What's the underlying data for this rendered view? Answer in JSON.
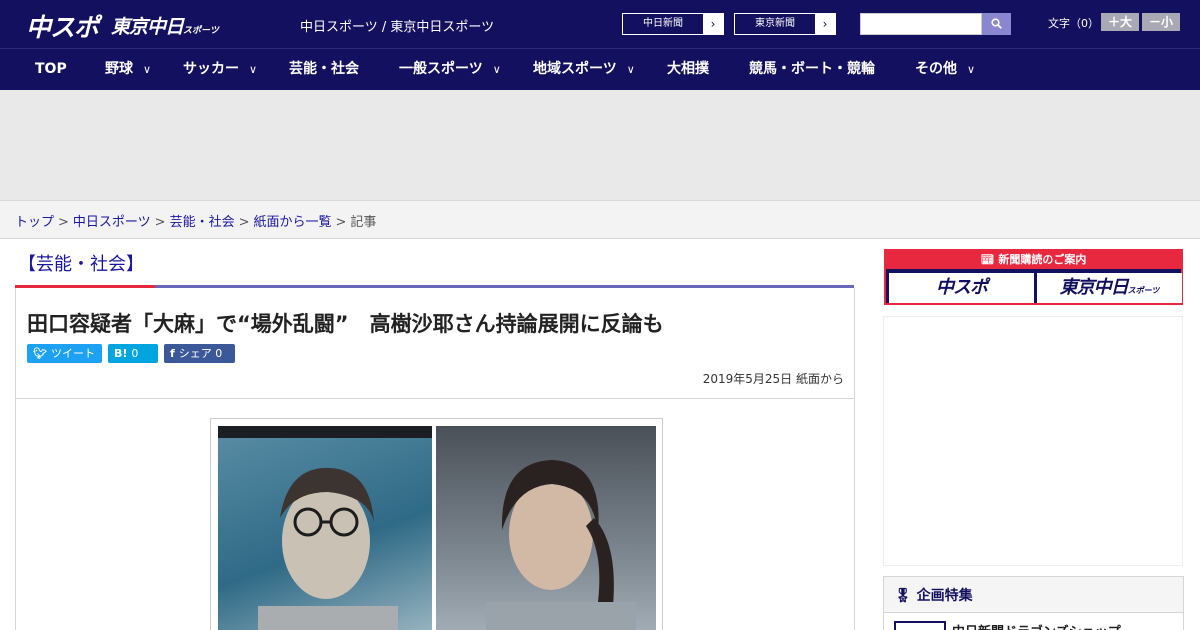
{
  "header": {
    "logo_chuspo": "中スポ",
    "logo_tokyo": "東京中日",
    "logo_tokyo_suffix": "スポーツ",
    "site_links": "中日スポーツ / 東京中日スポーツ",
    "paper_links": [
      "中日新聞",
      "東京新聞"
    ],
    "search": {
      "placeholder": "",
      "value": ""
    },
    "fontsize_label": "文字（0）",
    "fontsize_up": "＋大",
    "fontsize_down": "－小"
  },
  "nav": {
    "items": [
      {
        "label": "TOP"
      },
      {
        "label": "野球"
      },
      {
        "label": "サッカー"
      },
      {
        "label": "芸能・社会"
      },
      {
        "label": "一般スポーツ"
      },
      {
        "label": "地域スポーツ"
      },
      {
        "label": "大相撲"
      },
      {
        "label": "競馬・ボート・競輪"
      },
      {
        "label": "その他"
      }
    ]
  },
  "breadcrumb": {
    "items": [
      "トップ",
      "中日スポーツ",
      "芸能・社会",
      "紙面から一覧"
    ],
    "current": "記事",
    "separator": ">"
  },
  "article": {
    "section": "【芸能・社会】",
    "headline": "田口容疑者「大麻」で“場外乱闘”　高樹沙耶さん持論展開に反論も",
    "share": {
      "tweet_label": "ツイート",
      "hatena_count": "0",
      "facebook_label": "シェア",
      "facebook_count": "0"
    },
    "dateline": "2019年5月25日 紙面から"
  },
  "sidebar": {
    "subscribe_title": "新聞購読のご案内",
    "subscribe_logo_1": "中スポ",
    "subscribe_logo_2": "東京中日",
    "subscribe_logo_2_suffix": "スポーツ",
    "feature_title": "企画特集",
    "feature_item": "中日新聞ドラゴンズショップ"
  },
  "colors": {
    "brand_navy": "#13105f",
    "accent_red": "#e7283f",
    "link_blue": "#1a16a0",
    "twitter": "#1da1f2",
    "hatena": "#00a4de",
    "facebook": "#3b5998"
  }
}
